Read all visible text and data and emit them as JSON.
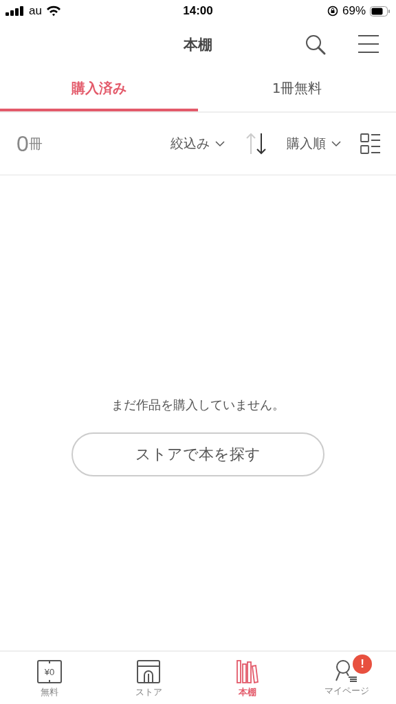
{
  "status_bar": {
    "carrier": "au",
    "time": "14:00",
    "battery": "69%"
  },
  "header": {
    "title": "本棚"
  },
  "tabs": [
    {
      "label": "購入済み",
      "selected": true
    },
    {
      "label": "1冊無料",
      "selected": false
    }
  ],
  "toolbar": {
    "count": "0",
    "count_unit": "冊",
    "filter": "絞込み",
    "sort": "購入順"
  },
  "empty_state": {
    "message": "まだ作品を購入していません。",
    "button": "ストアで本を探す"
  },
  "tab_bar": [
    {
      "kind": "free",
      "label": "無料",
      "icon_text": "¥0",
      "selected": false
    },
    {
      "kind": "store",
      "label": "ストア",
      "selected": false
    },
    {
      "kind": "shelf",
      "label": "本棚",
      "selected": true
    },
    {
      "kind": "mypage",
      "label": "マイページ",
      "badge": "!",
      "selected": false
    }
  ]
}
